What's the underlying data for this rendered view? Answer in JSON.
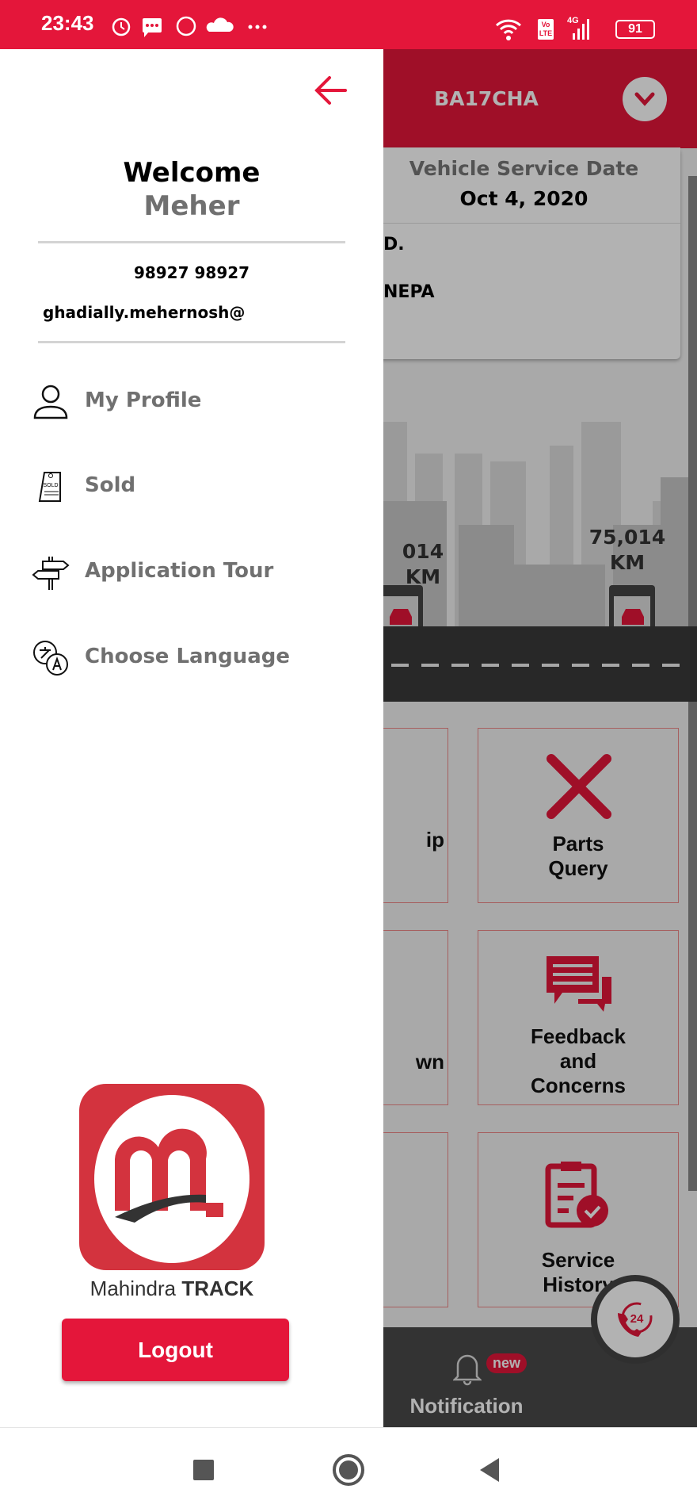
{
  "status_bar": {
    "time": "23:43",
    "battery": "91",
    "network": "4G",
    "volte": "Vo LTE",
    "icons": [
      "alarm-icon",
      "message-icon",
      "whatsapp-icon",
      "cloud-icon",
      "more-icon",
      "wifi-icon",
      "signal-icon",
      "battery-icon"
    ]
  },
  "header": {
    "vehicle": "BA17CHA"
  },
  "card": {
    "service_title": "Vehicle Service Date",
    "service_date": "Oct 4, 2020",
    "row1": "D.",
    "row2": "NEPA"
  },
  "odometer": {
    "left_km": "014 KM",
    "right_km_line1": "75,014",
    "right_km_line2": "KM"
  },
  "tiles": [
    {
      "label": "ip"
    },
    {
      "label_line1": "Parts",
      "label_line2": "Query"
    },
    {
      "label": "wn"
    },
    {
      "label_line1": "Feedback",
      "label_line2": "and",
      "label_line3": "Concerns"
    },
    {
      "label": ""
    },
    {
      "label_line1": "Service",
      "label_line2": "History"
    }
  ],
  "bottom_nav": {
    "notification": "Notification",
    "badge": "new",
    "helpline": "24"
  },
  "drawer": {
    "welcome": "Welcome",
    "name": "Meher",
    "phone": "98927 98927",
    "email": "ghadially.mehernosh@",
    "menu": [
      {
        "label": "My Profile",
        "icon": "user-icon"
      },
      {
        "label": "Sold",
        "icon": "sold-tag-icon",
        "icon_text": "SOLD"
      },
      {
        "label": "Application Tour",
        "icon": "signpost-icon"
      },
      {
        "label": "Choose Language",
        "icon": "translate-icon"
      }
    ],
    "logo_text_a": "Mahindra",
    "logo_text_b": "TRACK",
    "logout": "Logout"
  },
  "colors": {
    "brand_red": "#e4163a",
    "menu_text": "#707070"
  }
}
